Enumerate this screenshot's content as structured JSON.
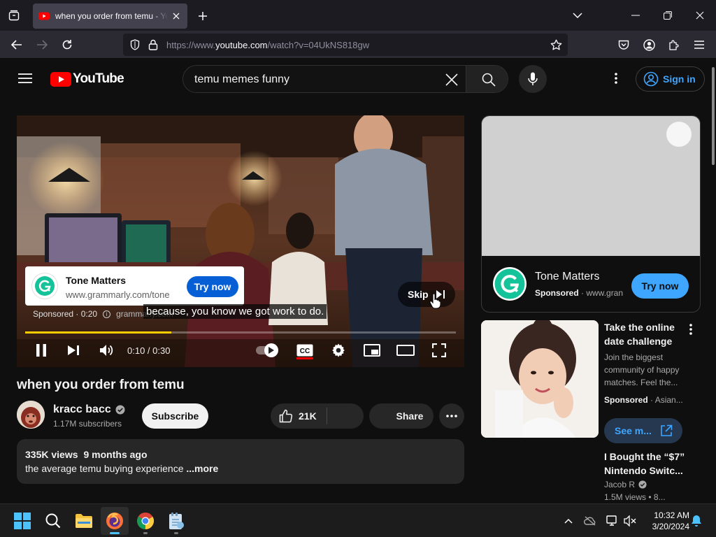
{
  "browser": {
    "tab_title": "when you order from temu - YouTube",
    "url_prefix": "https://www.",
    "url_host": "youtube.com",
    "url_path": "/watch?v=04UkNS818gw"
  },
  "header": {
    "logo_text": "YouTube",
    "search_query": "temu memes funny",
    "signin_label": "Sign in"
  },
  "player": {
    "ad_title": "Tone Matters",
    "ad_domain": "www.grammarly.com/tone",
    "ad_cta": "Try now",
    "ad_info_label": "Sponsored · 0:20",
    "ad_info_domain": "grammarly.com",
    "caption": "because, you know we got work to do.",
    "skip_label": "Skip",
    "time": "0:10 / 0:30",
    "progress_fraction": 0.34,
    "cc_label": "CC",
    "colors": {
      "progress": "#ffcc00",
      "cc_active": "#ff0000"
    }
  },
  "video": {
    "title": "when you order from temu",
    "channel_name": "kracc bacc",
    "subscribers": "1.17M subscribers",
    "subscribe_label": "Subscribe",
    "likes": "21K",
    "share_label": "Share",
    "views": "335K views",
    "age": "9 months ago",
    "description": "the average temu buying experience",
    "more_label": "...more"
  },
  "sidebar_ad": {
    "title": "Tone Matters",
    "sponsored": "Sponsored",
    "domain": "www.gran",
    "cta": "Try now"
  },
  "recommendations": [
    {
      "title_line1": "Take the online",
      "title_line2": "date challenge",
      "desc_line1": "Join the biggest",
      "desc_line2": "community of happy",
      "desc_line3": "matches. Feel the...",
      "sponsored": "Sponsored",
      "advertiser": "Asian...",
      "cta": "See m..."
    },
    {
      "title_line1": "I Bought the “$7”",
      "title_line2": "Nintendo Switc...",
      "channel": "Jacob R",
      "views": "1.5M views",
      "age": "8..."
    }
  ],
  "taskbar": {
    "time": "10:32 AM",
    "date": "3/20/2024"
  }
}
